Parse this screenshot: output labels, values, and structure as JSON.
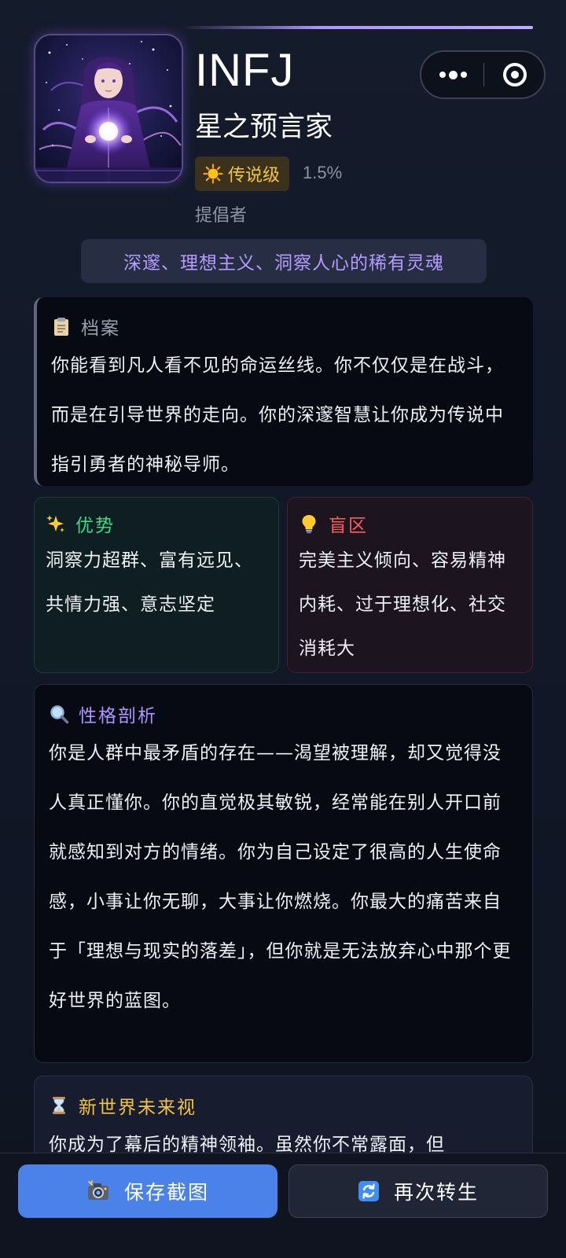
{
  "profile": {
    "mbti": "INFJ",
    "name": "星之预言家",
    "rarity_label": "传说级",
    "rarity_percent": "1.5%",
    "title": "提倡者",
    "tagline": "深邃、理想主义、洞察人心的稀有灵魂"
  },
  "archive": {
    "title": "档案",
    "icon": "clipboard-icon",
    "text": "你能看到凡人看不见的命运丝线。你不仅仅是在战斗，而是在引导世界的走向。你的深邃智慧让你成为传说中指引勇者的神秘导师。"
  },
  "strengths": {
    "title": "优势",
    "icon": "sparkles-icon",
    "text": "洞察力超群、富有远见、共情力强、意志坚定"
  },
  "blindspots": {
    "title": "盲区",
    "icon": "lightbulb-icon",
    "text": "完美主义倾向、容易精神内耗、过于理想化、社交消耗大"
  },
  "analysis": {
    "title": "性格剖析",
    "icon": "magnifier-icon",
    "text": "你是人群中最矛盾的存在——渴望被理解，却又觉得没人真正懂你。你的直觉极其敏锐，经常能在别人开口前就感知到对方的情绪。你为自己设定了很高的人生使命感，小事让你无聊，大事让你燃烧。你最大的痛苦来自于「理想与现实的落差」，但你就是无法放弃心中那个更好世界的蓝图。"
  },
  "future": {
    "title": "新世界未来视",
    "icon": "hourglass-icon",
    "text": "你成为了幕后的精神领袖。虽然你不常露面，但"
  },
  "actions": {
    "save_label": "保存截图",
    "rebirth_label": "再次转生"
  },
  "colors": {
    "accent_purple": "#b49cff",
    "strength_green": "#3ddc84",
    "blind_red": "#ff5d5d",
    "legend_gold": "#f4c447",
    "save_blue": "#4b82ea"
  }
}
